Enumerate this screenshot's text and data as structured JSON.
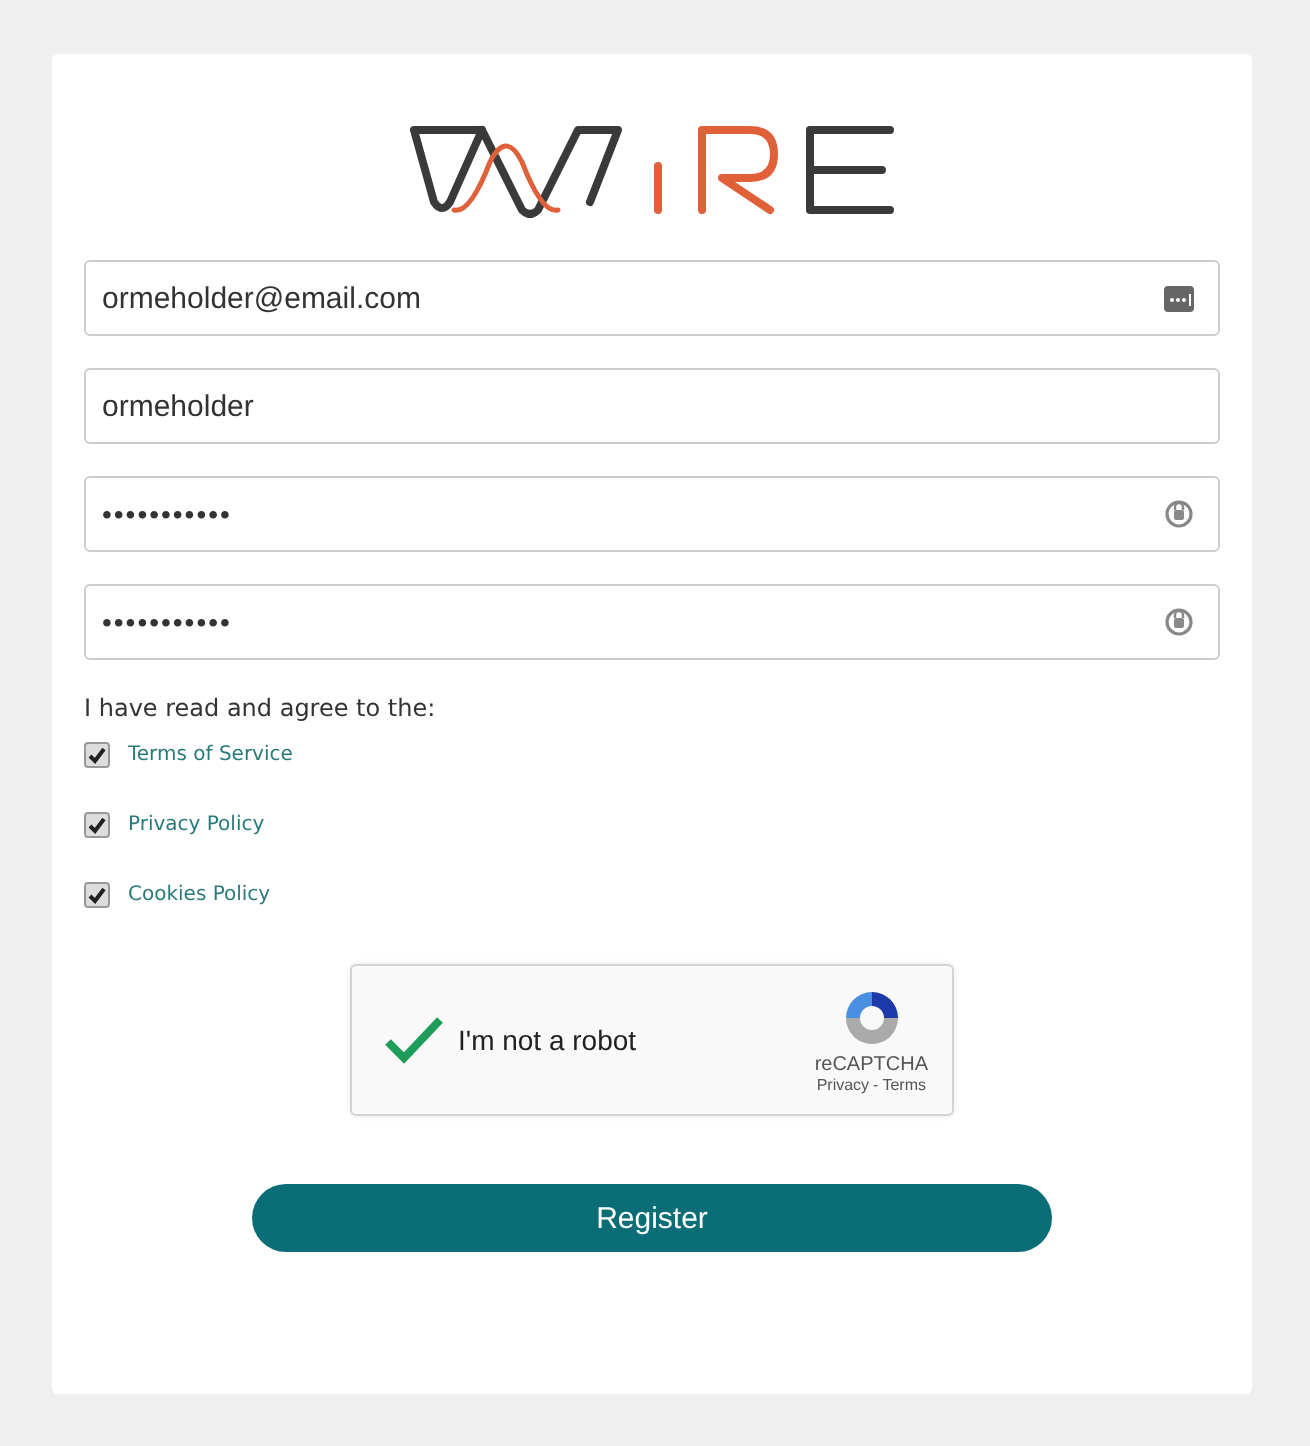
{
  "fields": [
    {
      "kind": "email",
      "value": "ormeholder@email.com"
    },
    {
      "kind": "text",
      "value": "ormeholder"
    },
    {
      "kind": "password",
      "value": "•••••••••••"
    },
    {
      "kind": "password",
      "value": "•••••••••••"
    }
  ],
  "agreement": {
    "label": "I have read and agree to the:",
    "items": [
      {
        "label": "Terms of Service",
        "checked": true
      },
      {
        "label": "Privacy Policy",
        "checked": true
      },
      {
        "label": "Cookies Policy",
        "checked": true
      }
    ]
  },
  "captcha": {
    "label": "I'm not a robot",
    "verified": true,
    "brand": "reCAPTCHA",
    "privacy": "Privacy",
    "separator": "-",
    "terms": "Terms"
  },
  "button": "Register"
}
